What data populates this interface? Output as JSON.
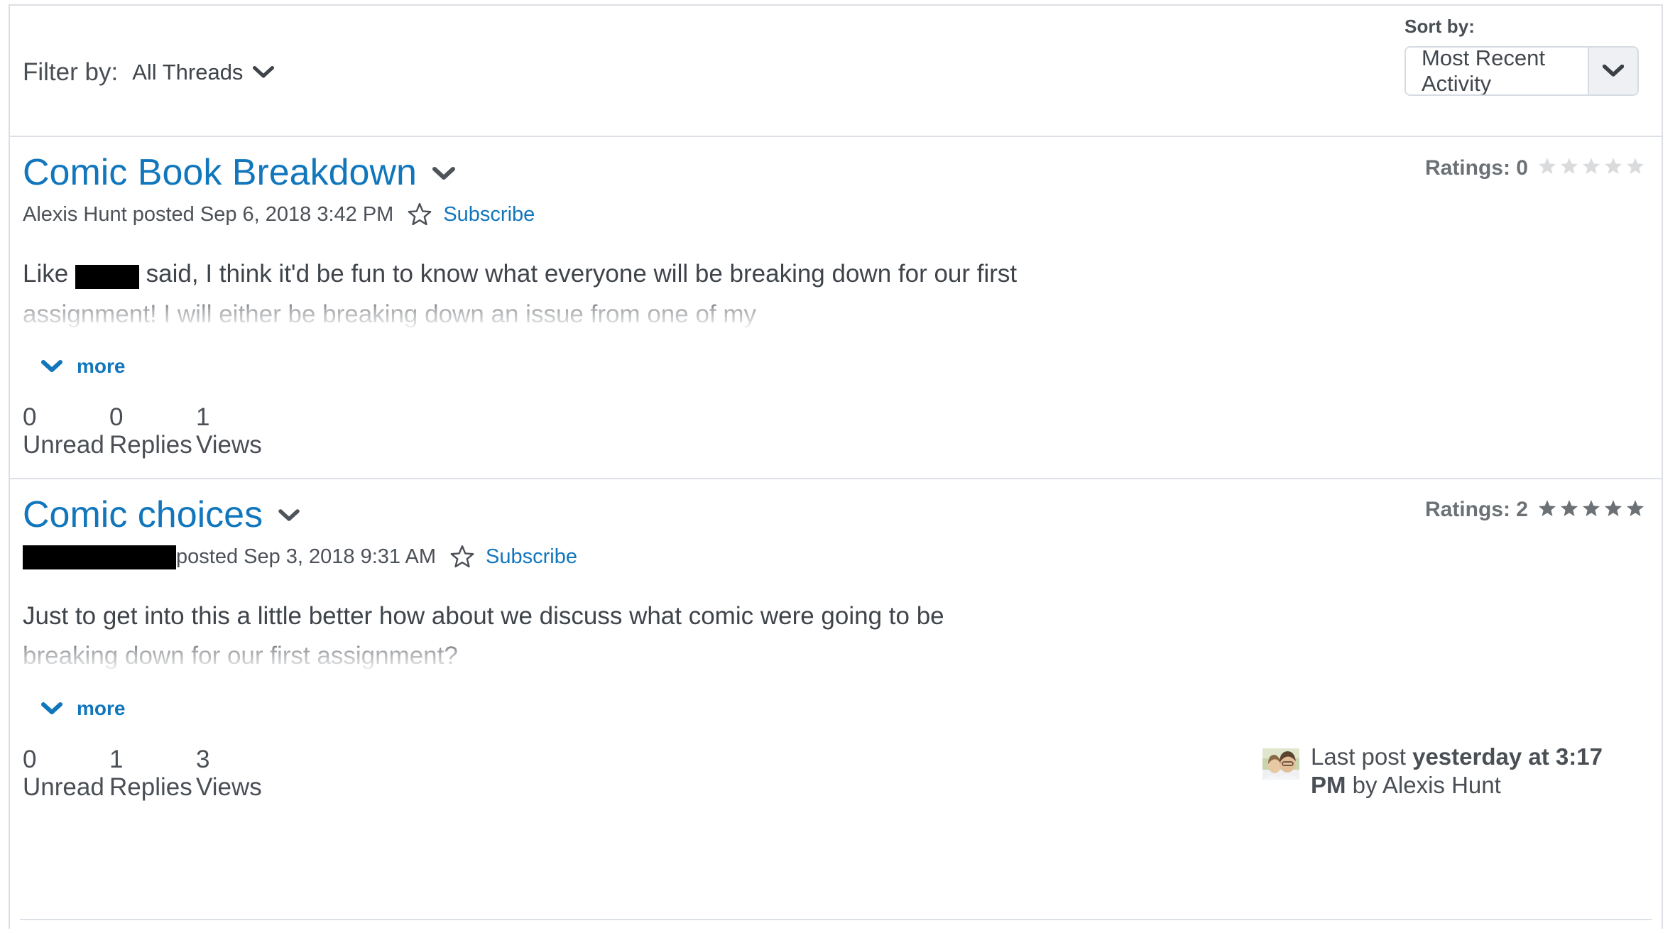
{
  "toolbar": {
    "filter_label": "Filter by:",
    "filter_value": "All Threads",
    "filter_chevron_icon": "chevron-down-icon",
    "sort_label": "Sort by:",
    "sort_value": "Most Recent Activity",
    "sort_chevron_icon": "chevron-down-icon"
  },
  "colors": {
    "link": "#1176bc",
    "text": "#4a4f55",
    "border": "#dde0e6",
    "star_empty": "#d9dbdd",
    "star_filled": "#6c7176",
    "redaction": "#000000"
  },
  "threads": [
    {
      "title": "Comic Book Breakdown",
      "title_chevron_icon": "chevron-down-icon",
      "author": "Alexis Hunt",
      "author_redacted": false,
      "posted_text": "Alexis Hunt posted Sep 6, 2018 3:42 PM",
      "subscribe_icon": "star-outline-icon",
      "subscribe_label": "Subscribe",
      "ratings_label": "Ratings: 0",
      "ratings_count": 0,
      "stars_total": 5,
      "stars_filled": 0,
      "body_prefix": "Like ",
      "body_redacted": true,
      "body_suffix": " said, I think it'd be fun to know what everyone will be breaking down for our first assignment! I will either be breaking down an issue from one of my",
      "more_label": "more",
      "more_chevron_icon": "chevron-down-icon",
      "stats": [
        {
          "num": "0",
          "label": "Unread"
        },
        {
          "num": "0",
          "label": "Replies"
        },
        {
          "num": "1",
          "label": "Views"
        }
      ],
      "has_last_post": false
    },
    {
      "title": "Comic choices",
      "title_chevron_icon": "chevron-down-icon",
      "author": "",
      "author_redacted": true,
      "posted_text": "posted Sep 3, 2018 9:31 AM",
      "subscribe_icon": "star-outline-icon",
      "subscribe_label": "Subscribe",
      "ratings_label": "Ratings: 2",
      "ratings_count": 2,
      "stars_total": 5,
      "stars_filled": 5,
      "body_prefix": "Just to get into this a little better how about we discuss what comic were going to be breaking down for our first assignment?",
      "body_redacted": false,
      "body_suffix": "",
      "more_label": "more",
      "more_chevron_icon": "chevron-down-icon",
      "stats": [
        {
          "num": "0",
          "label": "Unread"
        },
        {
          "num": "1",
          "label": "Replies"
        },
        {
          "num": "3",
          "label": "Views"
        }
      ],
      "has_last_post": true,
      "last_post": {
        "avatar_icon": "user-photo-avatar",
        "prefix": "Last post ",
        "when": "yesterday at 3:17 PM",
        "suffix": " by Alexis Hunt"
      }
    }
  ]
}
